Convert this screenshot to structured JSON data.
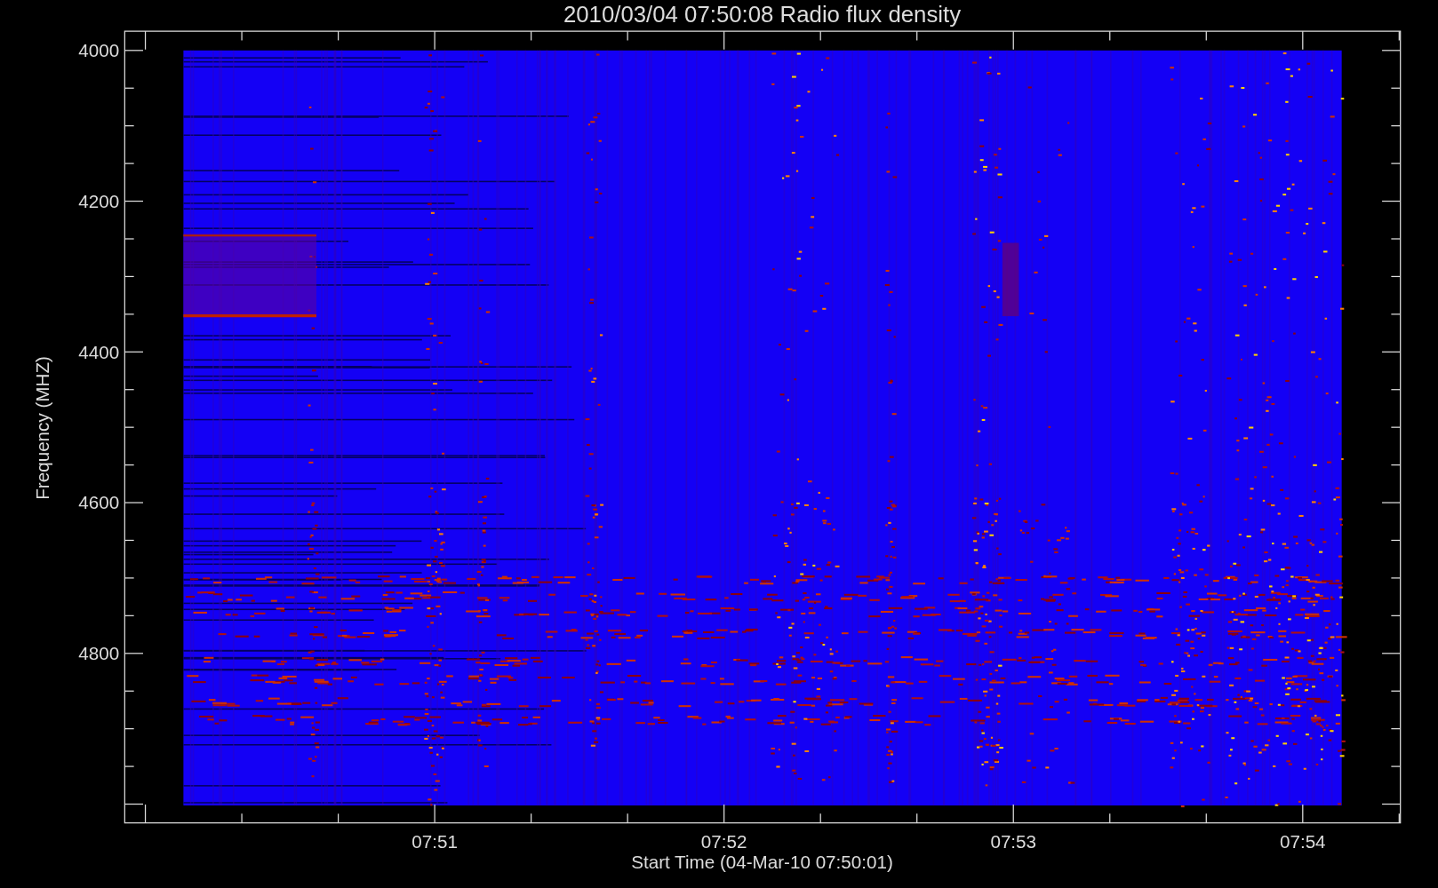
{
  "plot": {
    "title": "2010/03/04 07:50:08 Radio flux density",
    "ylabel": "Frequency (MHZ)",
    "yticks": [
      "4000",
      "4200",
      "4400",
      "4600",
      "4800"
    ],
    "xlabel": "Start Time (04-Mar-10 07:50:01)",
    "xticks": [
      "07:51",
      "07:52",
      "07:53",
      "07:54"
    ]
  }
}
